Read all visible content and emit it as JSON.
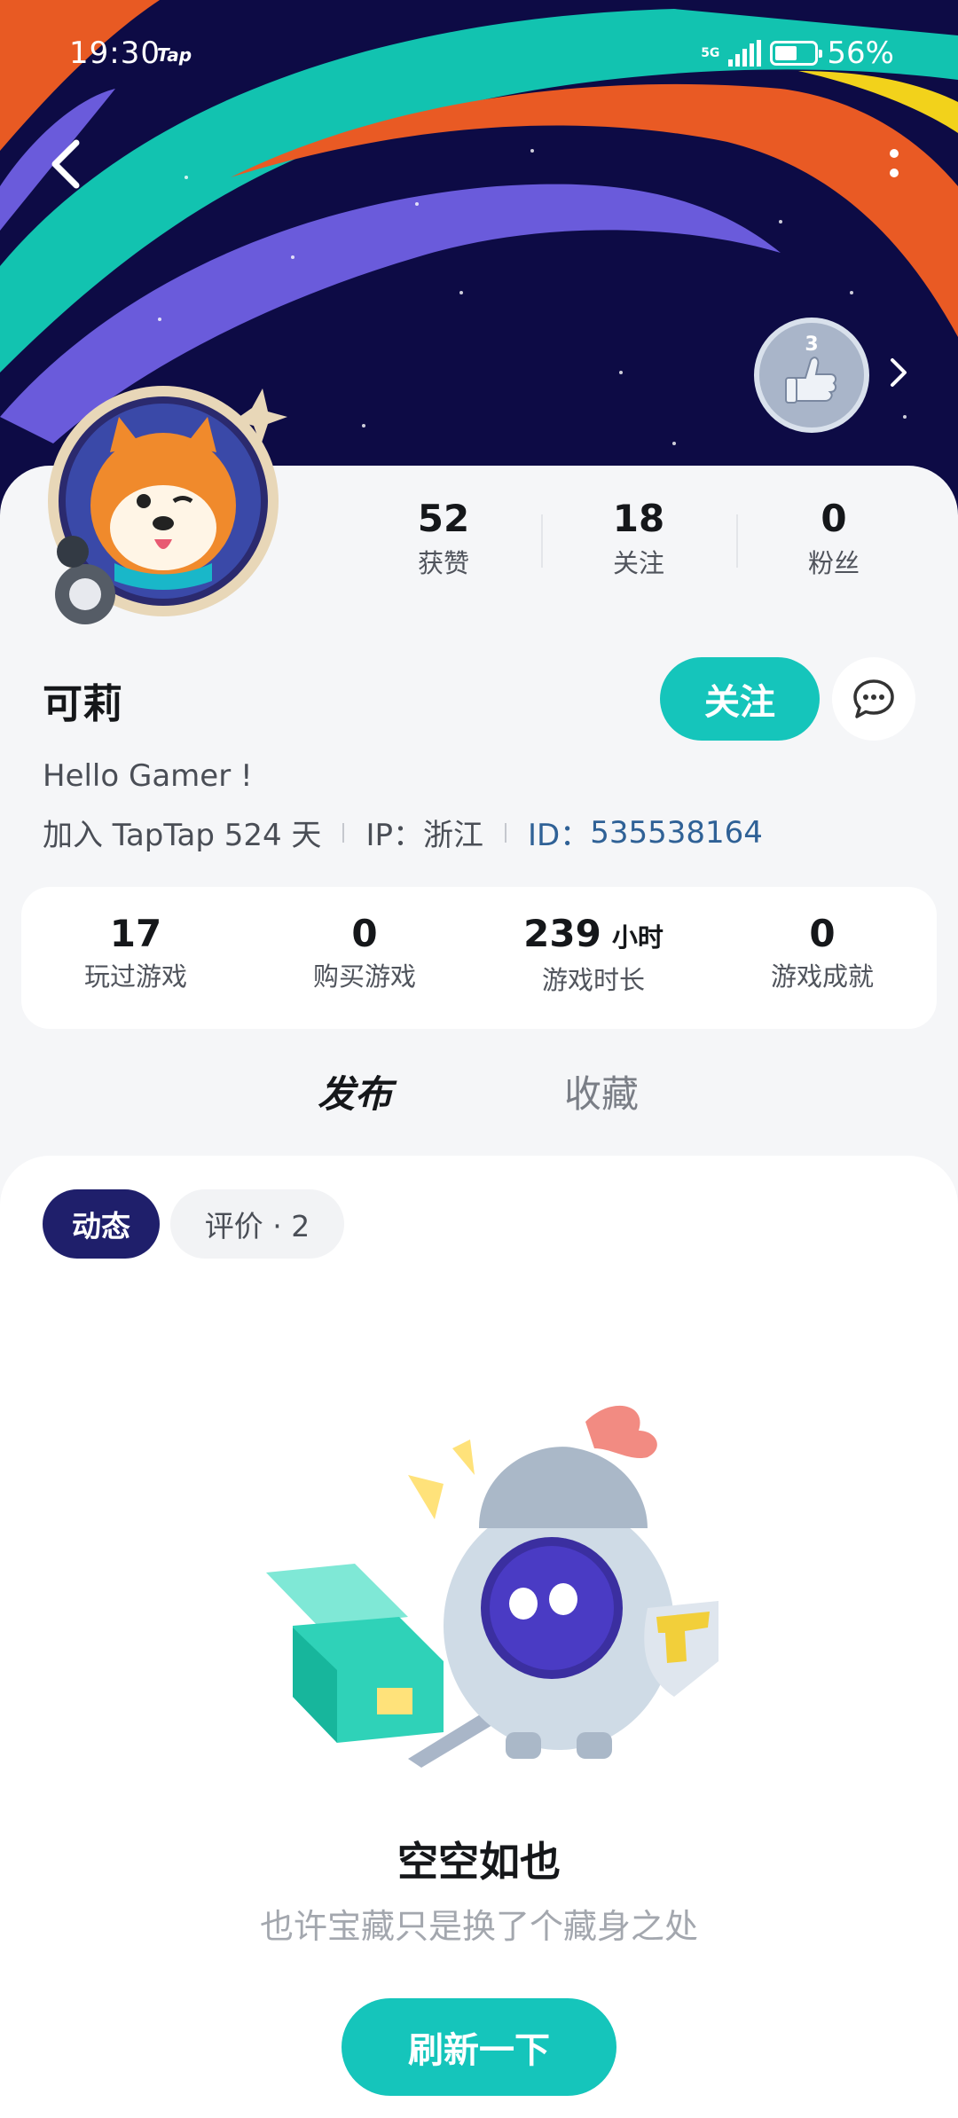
{
  "status_bar": {
    "time": "19:30",
    "app_tag": "Tap",
    "network": "5G",
    "battery": "56%"
  },
  "header": {
    "medal_level": "3"
  },
  "profile": {
    "name": "可莉",
    "follow_label": "关注",
    "bio": "Hello Gamer !",
    "joined": "加入 TapTap 524 天",
    "ip": "IP：浙江",
    "id_label": "ID：",
    "id_value": "535538164"
  },
  "social_stats": [
    {
      "value": "52",
      "label": "获赞"
    },
    {
      "value": "18",
      "label": "关注"
    },
    {
      "value": "0",
      "label": "粉丝"
    }
  ],
  "game_stats": [
    {
      "value": "17",
      "unit": "",
      "label": "玩过游戏"
    },
    {
      "value": "0",
      "unit": "",
      "label": "购买游戏"
    },
    {
      "value": "239",
      "unit": "小时",
      "label": "游戏时长"
    },
    {
      "value": "0",
      "unit": "",
      "label": "游戏成就"
    }
  ],
  "tabs": {
    "active": "发布",
    "inactive": "收藏"
  },
  "chips": {
    "active": "动态",
    "inactive": "评价 · 2"
  },
  "empty": {
    "title": "空空如也",
    "subtitle": "也许宝藏只是换了个藏身之处",
    "refresh_label": "刷新一下"
  },
  "colors": {
    "accent": "#15c5bb",
    "banner_bg": "#0d0b45",
    "chip_active": "#1f1f6b",
    "id_link": "#2f6196"
  }
}
